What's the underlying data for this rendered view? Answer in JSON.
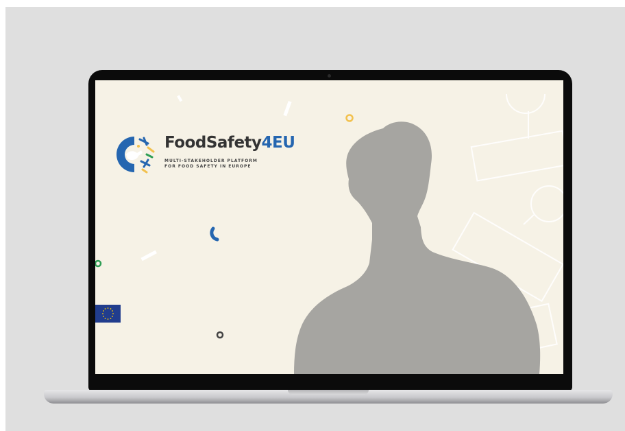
{
  "logo": {
    "name_part1": "FoodSafety",
    "name_part2": "4EU",
    "tagline_line1": "MULTI-STAKEHOLDER PLATFORM",
    "tagline_line2": "FOR FOOD SAFETY IN EUROPE"
  },
  "colors": {
    "brand_blue": "#2566b0",
    "brand_yellow": "#f2c14e",
    "brand_green": "#2f9e55",
    "screen_bg": "#f6f2e6",
    "silhouette": "#a6a5a1"
  },
  "icons": [
    "eu-flag-icon",
    "person-silhouette",
    "food-safety-emblem"
  ]
}
